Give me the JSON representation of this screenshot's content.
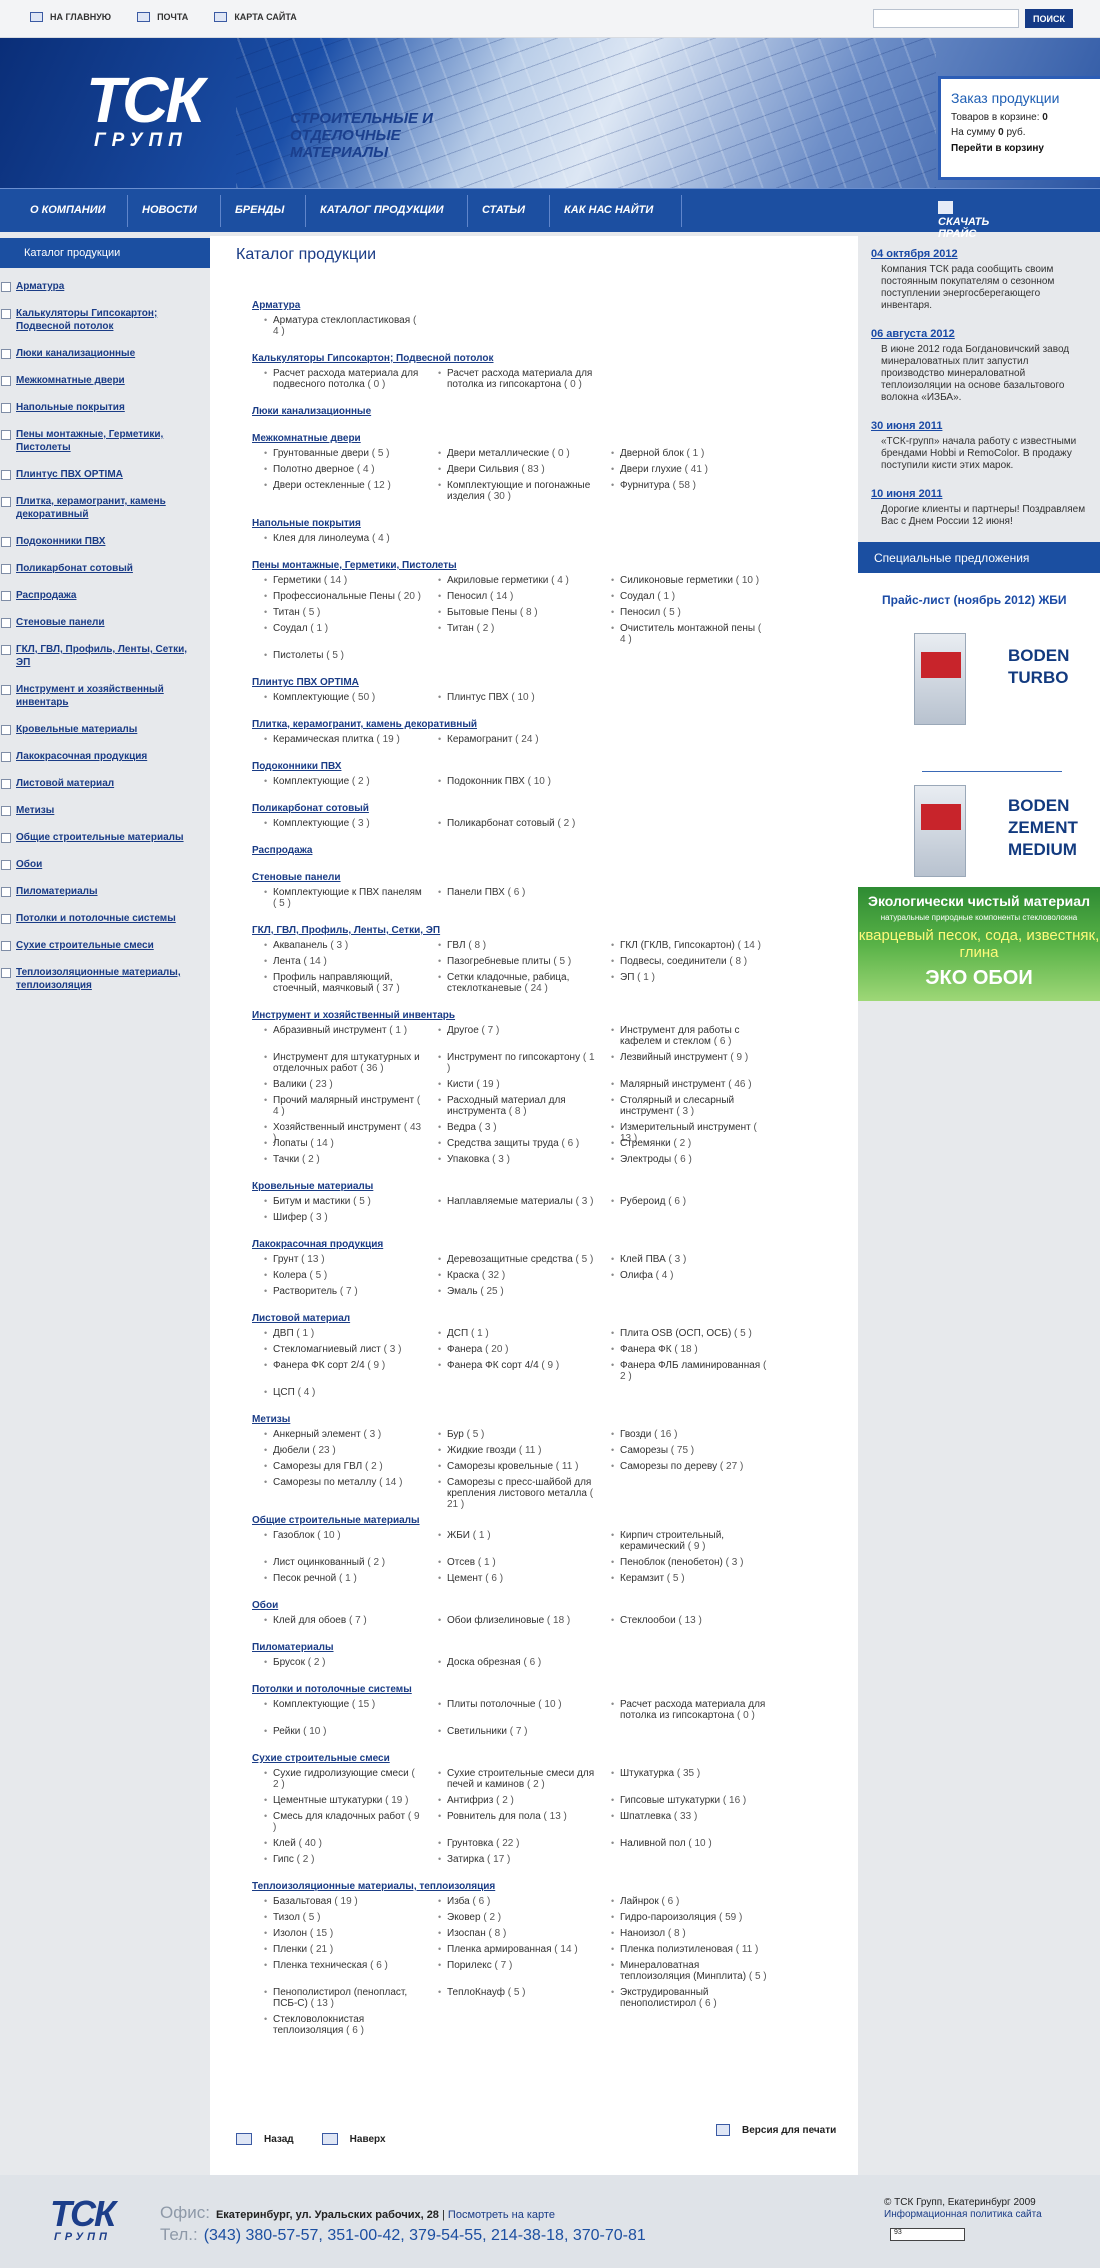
{
  "top": {
    "home": "На главную",
    "mail": "Почта",
    "map": "Карта сайта",
    "search_button": "ПОИСК",
    "search_value": ""
  },
  "banner": {
    "logo": "ТСК",
    "logo_sub": "ГРУПП",
    "slogan": "Строительные и отделочные материалы"
  },
  "order": {
    "title": "Заказ продукции",
    "items_label": "Товаров в корзине:",
    "items_value": "0",
    "sum_label": "На сумму",
    "sum_value": "0",
    "sum_unit": "руб.",
    "cart_link": "Перейти в корзину"
  },
  "nav": [
    "О компании",
    "Новости",
    "Бренды",
    "Каталог продукции",
    "Статьи",
    "Как нас найти"
  ],
  "price_link": "Скачать прайс",
  "sidebar": {
    "title": "Каталог продукции",
    "items": [
      "Арматура",
      "Калькуляторы Гипсокартон; Подвесной потолок",
      "Люки канализационные",
      "Межкомнатные двери",
      "Напольные покрытия",
      "Пены монтажные, Герметики, Пистолеты",
      "Плинтус ПВХ OPTIMA",
      "Плитка, керамогранит, камень декоративный",
      "Подоконники ПВХ",
      "Поликарбонат сотовый",
      "Распродажа",
      "Стеновые панели",
      "ГКЛ, ГВЛ, Профиль, Ленты, Сетки, ЭП",
      "Инструмент и хозяйственный инвентарь",
      "Кровельные материалы",
      "Лакокрасочная продукция",
      "Листовой материал",
      "Метизы",
      "Общие строительные материалы",
      "Обои",
      "Пиломатериалы",
      "Потолки и потолочные системы",
      "Сухие строительные смеси",
      "Теплоизоляционные материалы, теплоизоляция"
    ]
  },
  "main": {
    "title": "Каталог продукции",
    "back": "Назад",
    "up": "Наверх",
    "print": "Версия для печати",
    "sections": [
      {
        "t": "Арматура",
        "i": [
          [
            "Арматура стеклопластиковая",
            "4"
          ]
        ]
      },
      {
        "t": "Калькуляторы Гипсокартон; Подвесной потолок",
        "i": [
          [
            "Расчет расхода материала для подвесного потолка",
            "0"
          ],
          [
            "Расчет расхода материала для потолка из гипсокартона",
            "0"
          ]
        ]
      },
      {
        "t": "Люки канализационные",
        "i": []
      },
      {
        "t": "Межкомнатные двери",
        "i": [
          [
            "Грунтованные двери",
            "5"
          ],
          [
            "Двери металлические",
            "0"
          ],
          [
            "Дверной блок",
            "1"
          ],
          [
            "Полотно дверное",
            "4"
          ],
          [
            "Двери Сильвия",
            "83"
          ],
          [
            "Двери глухие",
            "41"
          ],
          [
            "Двери остекленные",
            "12"
          ],
          [
            "Комплектующие и погонажные изделия",
            "30"
          ],
          [
            "Фурнитура",
            "58"
          ]
        ]
      },
      {
        "t": "Напольные покрытия",
        "i": [
          [
            "Клея для линолеума",
            "4"
          ]
        ]
      },
      {
        "t": "Пены монтажные, Герметики, Пистолеты",
        "i": [
          [
            "Герметики",
            "14"
          ],
          [
            "Акриловые герметики",
            "4"
          ],
          [
            "Силиконовые герметики",
            "10"
          ],
          [
            "Профессиональные Пены",
            "20"
          ],
          [
            "Пеносил",
            "14"
          ],
          [
            "Соудал",
            "1"
          ],
          [
            "Титан",
            "5"
          ],
          [
            "Бытовые Пены",
            "8"
          ],
          [
            "Пеносил",
            "5"
          ],
          [
            "Соудал",
            "1"
          ],
          [
            "Титан",
            "2"
          ],
          [
            "Очиститель монтажной пены",
            "4"
          ],
          [
            "Пистолеты",
            "5"
          ]
        ]
      },
      {
        "t": "Плинтус ПВХ OPTIMA",
        "i": [
          [
            "Комплектующие",
            "50"
          ],
          [
            "Плинтус ПВХ",
            "10"
          ]
        ]
      },
      {
        "t": "Плитка, керамогранит, камень декоративный",
        "i": [
          [
            "Керамическая плитка",
            "19"
          ],
          [
            "Керамогранит",
            "24"
          ]
        ]
      },
      {
        "t": "Подоконники ПВХ",
        "i": [
          [
            "Комплектующие",
            "2"
          ],
          [
            "Подоконник ПВХ",
            "10"
          ]
        ]
      },
      {
        "t": "Поликарбонат сотовый",
        "i": [
          [
            "Комплектующие",
            "3"
          ],
          [
            "Поликарбонат сотовый",
            "2"
          ]
        ]
      },
      {
        "t": "Распродажа",
        "i": []
      },
      {
        "t": "Стеновые панели",
        "i": [
          [
            "Комплектующие к ПВХ панелям",
            "5"
          ],
          [
            "Панели ПВХ",
            "6"
          ]
        ]
      },
      {
        "t": "ГКЛ, ГВЛ, Профиль, Ленты, Сетки, ЭП",
        "i": [
          [
            "Аквапанель",
            "3"
          ],
          [
            "ГВЛ",
            "8"
          ],
          [
            "ГКЛ (ГКЛВ, Гипсокартон)",
            "14"
          ],
          [
            "Лента",
            "14"
          ],
          [
            "Пазогребневые плиты",
            "5"
          ],
          [
            "Подвесы, соединители",
            "8"
          ],
          [
            "Профиль направляющий, стоечный, маячковый",
            "37"
          ],
          [
            "Сетки кладочные, рабица, стеклотканевые",
            "24"
          ],
          [
            "ЭП",
            "1"
          ]
        ]
      },
      {
        "t": "Инструмент и хозяйственный инвентарь",
        "i": [
          [
            "Абразивный инструмент",
            "1"
          ],
          [
            "Другое",
            "7"
          ],
          [
            "Инструмент для работы с кафелем и стеклом",
            "6"
          ],
          [
            "Инструмент для штукатурных и отделочных работ",
            "36"
          ],
          [
            "Инструмент по гипсокартону",
            "1"
          ],
          [
            "Лезвийный инструмент",
            "9"
          ],
          [
            "Валики",
            "23"
          ],
          [
            "Кисти",
            "19"
          ],
          [
            "Малярный инструмент",
            "46"
          ],
          [
            "Прочий малярный инструмент",
            "4"
          ],
          [
            "Расходный материал для инструмента",
            "8"
          ],
          [
            "Столярный и слесарный инструмент",
            "3"
          ],
          [
            "Хозяйственный инструмент",
            "43"
          ],
          [
            "Ведра",
            "3"
          ],
          [
            "Измерительный инструмент",
            "13"
          ],
          [
            "Лопаты",
            "14"
          ],
          [
            "Средства защиты труда",
            "6"
          ],
          [
            "Стремянки",
            "2"
          ],
          [
            "Тачки",
            "2"
          ],
          [
            "Упаковка",
            "3"
          ],
          [
            "Электроды",
            "6"
          ]
        ]
      },
      {
        "t": "Кровельные материалы",
        "i": [
          [
            "Битум и мастики",
            "5"
          ],
          [
            "Наплавляемые материалы",
            "3"
          ],
          [
            "Рубероид",
            "6"
          ],
          [
            "Шифер",
            "3"
          ]
        ]
      },
      {
        "t": "Лакокрасочная продукция",
        "i": [
          [
            "Грунт",
            "13"
          ],
          [
            "Деревозащитные средства",
            "5"
          ],
          [
            "Клей ПВА",
            "3"
          ],
          [
            "Колера",
            "5"
          ],
          [
            "Краска",
            "32"
          ],
          [
            "Олифа",
            "4"
          ],
          [
            "Растворитель",
            "7"
          ],
          [
            "Эмаль",
            "25"
          ]
        ]
      },
      {
        "t": "Листовой материал",
        "i": [
          [
            "ДВП",
            "1"
          ],
          [
            "ДСП",
            "1"
          ],
          [
            "Плита OSB (ОСП, ОСБ)",
            "5"
          ],
          [
            "Стекломагниевый лист",
            "3"
          ],
          [
            "Фанера",
            "20"
          ],
          [
            "Фанера ФК",
            "18"
          ],
          [
            "Фанера ФК сорт 2/4",
            "9"
          ],
          [
            "Фанера ФК сорт 4/4",
            "9"
          ],
          [
            "Фанера ФЛБ ламинированная",
            "2"
          ],
          [
            "ЦСП",
            "4"
          ]
        ]
      },
      {
        "t": "Метизы",
        "i": [
          [
            "Анкерный элемент",
            "3"
          ],
          [
            "Бур",
            "5"
          ],
          [
            "Гвозди",
            "16"
          ],
          [
            "Дюбели",
            "23"
          ],
          [
            "Жидкие гвозди",
            "11"
          ],
          [
            "Саморезы",
            "75"
          ],
          [
            "Саморезы для ГВЛ",
            "2"
          ],
          [
            "Саморезы кровельные",
            "11"
          ],
          [
            "Саморезы по дереву",
            "27"
          ],
          [
            "Саморезы по металлу",
            "14"
          ],
          [
            "Саморезы с пресс-шайбой для крепления листового металла",
            "21"
          ]
        ]
      },
      {
        "t": "Общие строительные материалы",
        "i": [
          [
            "Газоблок",
            "10"
          ],
          [
            "ЖБИ",
            "1"
          ],
          [
            "Кирпич строительный, керамический",
            "9"
          ],
          [
            "Лист оцинкованный",
            "2"
          ],
          [
            "Отсев",
            "1"
          ],
          [
            "Пеноблок (пенобетон)",
            "3"
          ],
          [
            "Песок речной",
            "1"
          ],
          [
            "Цемент",
            "6"
          ],
          [
            "Керамзит",
            "5"
          ]
        ]
      },
      {
        "t": "Обои",
        "i": [
          [
            "Клей для обоев",
            "7"
          ],
          [
            "Обои флизелиновые",
            "18"
          ],
          [
            "Стеклообои",
            "13"
          ]
        ]
      },
      {
        "t": "Пиломатериалы",
        "i": [
          [
            "Брусок",
            "2"
          ],
          [
            "Доска обрезная",
            "6"
          ]
        ]
      },
      {
        "t": "Потолки и потолочные системы",
        "i": [
          [
            "Комплектующие",
            "15"
          ],
          [
            "Плиты потолочные",
            "10"
          ],
          [
            "Расчет расхода материала для потолка из гипсокартона",
            "0"
          ],
          [
            "Рейки",
            "10"
          ],
          [
            "Светильники",
            "7"
          ]
        ]
      },
      {
        "t": "Сухие строительные смеси",
        "i": [
          [
            "Сухие гидролизующие смеси",
            "2"
          ],
          [
            "Сухие строительные смеси для печей и каминов",
            "2"
          ],
          [
            "Штукатурка",
            "35"
          ],
          [
            "Цементные штукатурки",
            "19"
          ],
          [
            "Антифриз",
            "2"
          ],
          [
            "Гипсовые штукатурки",
            "16"
          ],
          [
            "Смесь для кладочных работ",
            "9"
          ],
          [
            "Ровнитель для пола",
            "13"
          ],
          [
            "Шпатлевка",
            "33"
          ],
          [
            "Клей",
            "40"
          ],
          [
            "Грунтовка",
            "22"
          ],
          [
            "Наливной пол",
            "10"
          ],
          [
            "Гипс",
            "2"
          ],
          [
            "Затирка",
            "17"
          ]
        ]
      },
      {
        "t": "Теплоизоляционные материалы, теплоизоляция",
        "i": [
          [
            "Базальтовая",
            "19"
          ],
          [
            "Изба",
            "6"
          ],
          [
            "Лайнрок",
            "6"
          ],
          [
            "Тизол",
            "5"
          ],
          [
            "Эковер",
            "2"
          ],
          [
            "Гидро-пароизоляция",
            "59"
          ],
          [
            "Изолон",
            "15"
          ],
          [
            "Изоспан",
            "8"
          ],
          [
            "Наноизол",
            "8"
          ],
          [
            "Пленки",
            "21"
          ],
          [
            "Пленка армированная",
            "14"
          ],
          [
            "Пленка полиэтиленовая",
            "11"
          ],
          [
            "Пленка техническая",
            "6"
          ],
          [
            "Порилекс",
            "7"
          ],
          [
            "Минераловатная теплоизоляция (Минплита)",
            "5"
          ],
          [
            "Пенополистирол (пенопласт, ПСБ-С)",
            "13"
          ],
          [
            "ТеплоКнауф",
            "5"
          ],
          [
            "Экструдированный пенополистирол",
            "6"
          ],
          [
            "Стекловолокнистая теплоизоляция",
            "6"
          ]
        ]
      }
    ]
  },
  "news": [
    {
      "date": "04 октября 2012",
      "text": "Компания ТСК рада сообщить своим постоянным покупателям о сезонном поступлении энергосберегающего инвентаря."
    },
    {
      "date": "06 августа 2012",
      "text": "В июне 2012 года Богдановичский завод минераловатных плит запустил производство минераловатной теплоизоляции на основе базальтового волокна «ИЗБА»."
    },
    {
      "date": "30 июня 2011",
      "text": "«ТСК-групп» начала работу с известными брендами Hobbi и RemoColor. В продажу поступили кисти этих марок."
    },
    {
      "date": "10 июня 2011",
      "text": "Дорогие клиенты и партнеры! Поздравляем Вас с Днем России 12 июня!"
    }
  ],
  "special": {
    "title": "Специальные предложения",
    "price_link": "Прайс-лист (ноябрь 2012) ЖБИ",
    "brand1": "BODEN TURBO",
    "brand2": "BODEN ZEMENT MEDIUM",
    "eco1": "Экологически чистый материал",
    "eco2": "натуральные природные компоненты стекловолокна",
    "eco3": "кварцевый песок, сода, известняк, глина",
    "eco4": "ЭКО ОБОИ"
  },
  "footer": {
    "logo": "ТСК",
    "logo_sub": "ГРУПП",
    "office_label": "Офис:",
    "address": "Екатеринбург, ул. Уральских рабочих, 28",
    "map_link": "Посмотреть на карте",
    "tel_label": "Тел.:",
    "phones": "(343) 380-57-57, 351-00-42, 379-54-55, 214-38-18, 370-70-81",
    "copyright": "© ТСК Групп, Екатеринбург 2009",
    "policy": "Информационная политика сайта",
    "counter": "93"
  }
}
